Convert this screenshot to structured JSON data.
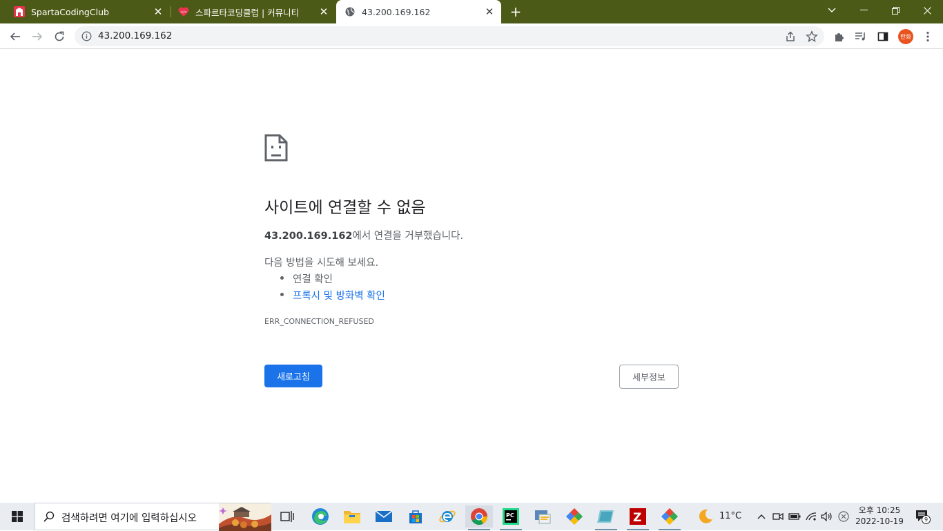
{
  "tabs": [
    {
      "title": "SpartaCodingClub",
      "active": false
    },
    {
      "title": "스파르타코딩클럽 | 커뮤니티",
      "active": false
    },
    {
      "title": "43.200.169.162",
      "active": true
    }
  ],
  "toolbar": {
    "url": "43.200.169.162",
    "profile_label": "란화"
  },
  "error": {
    "title": "사이트에 연결할 수 없음",
    "host": "43.200.169.162",
    "desc_suffix": "에서 연결을 거부했습니다.",
    "try_label": "다음 방법을 시도해 보세요.",
    "suggestions": [
      "연결 확인",
      "프록시 및 방화벽 확인"
    ],
    "code": "ERR_CONNECTION_REFUSED",
    "reload_label": "새로고침",
    "details_label": "세부정보"
  },
  "taskbar": {
    "search_placeholder": "검색하려면 여기에 입력하십시오",
    "weather": "11°C",
    "time": "오후 10:25",
    "date": "2022-10-19",
    "notification_count": "9"
  },
  "colors": {
    "titlebar": "#4b5a16",
    "accent": "#1a73e8",
    "profile": "#e8531f"
  }
}
